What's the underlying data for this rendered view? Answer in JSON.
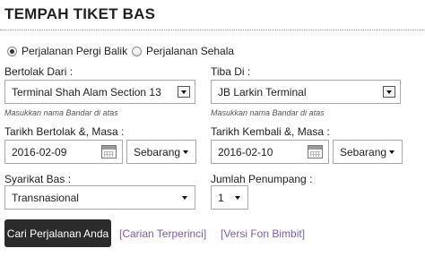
{
  "title": "TEMPAH TIKET BAS",
  "trip_type": {
    "round_trip_label": "Perjalanan Pergi Balik",
    "one_way_label": "Perjalanan Sehala",
    "selected": "round_trip"
  },
  "origin": {
    "label": "Bertolak Dari :",
    "value": "Terminal Shah Alam Section 13",
    "hint": "Masukkan nama Bandar di atas"
  },
  "destination": {
    "label": "Tiba Di :",
    "value": "JB Larkin Terminal",
    "hint": "Masukkan nama Bandar di atas"
  },
  "depart": {
    "label": "Tarikh Bertolak &, Masa :",
    "date": "2016-02-09",
    "time": "Sebarang"
  },
  "return": {
    "label": "Tarikh Kembali &, Masa :",
    "date": "2016-02-10",
    "time": "Sebarang"
  },
  "operator": {
    "label": "Syarikat Bas :",
    "value": "Transnasional"
  },
  "passengers": {
    "label": "Jumlah Penumpang :",
    "value": "1"
  },
  "actions": {
    "search_label": "Cari Perjalanan Anda",
    "advanced_link": "[Carian Terperinci]",
    "mobile_link": "[Versi Fon Bimbit]"
  }
}
